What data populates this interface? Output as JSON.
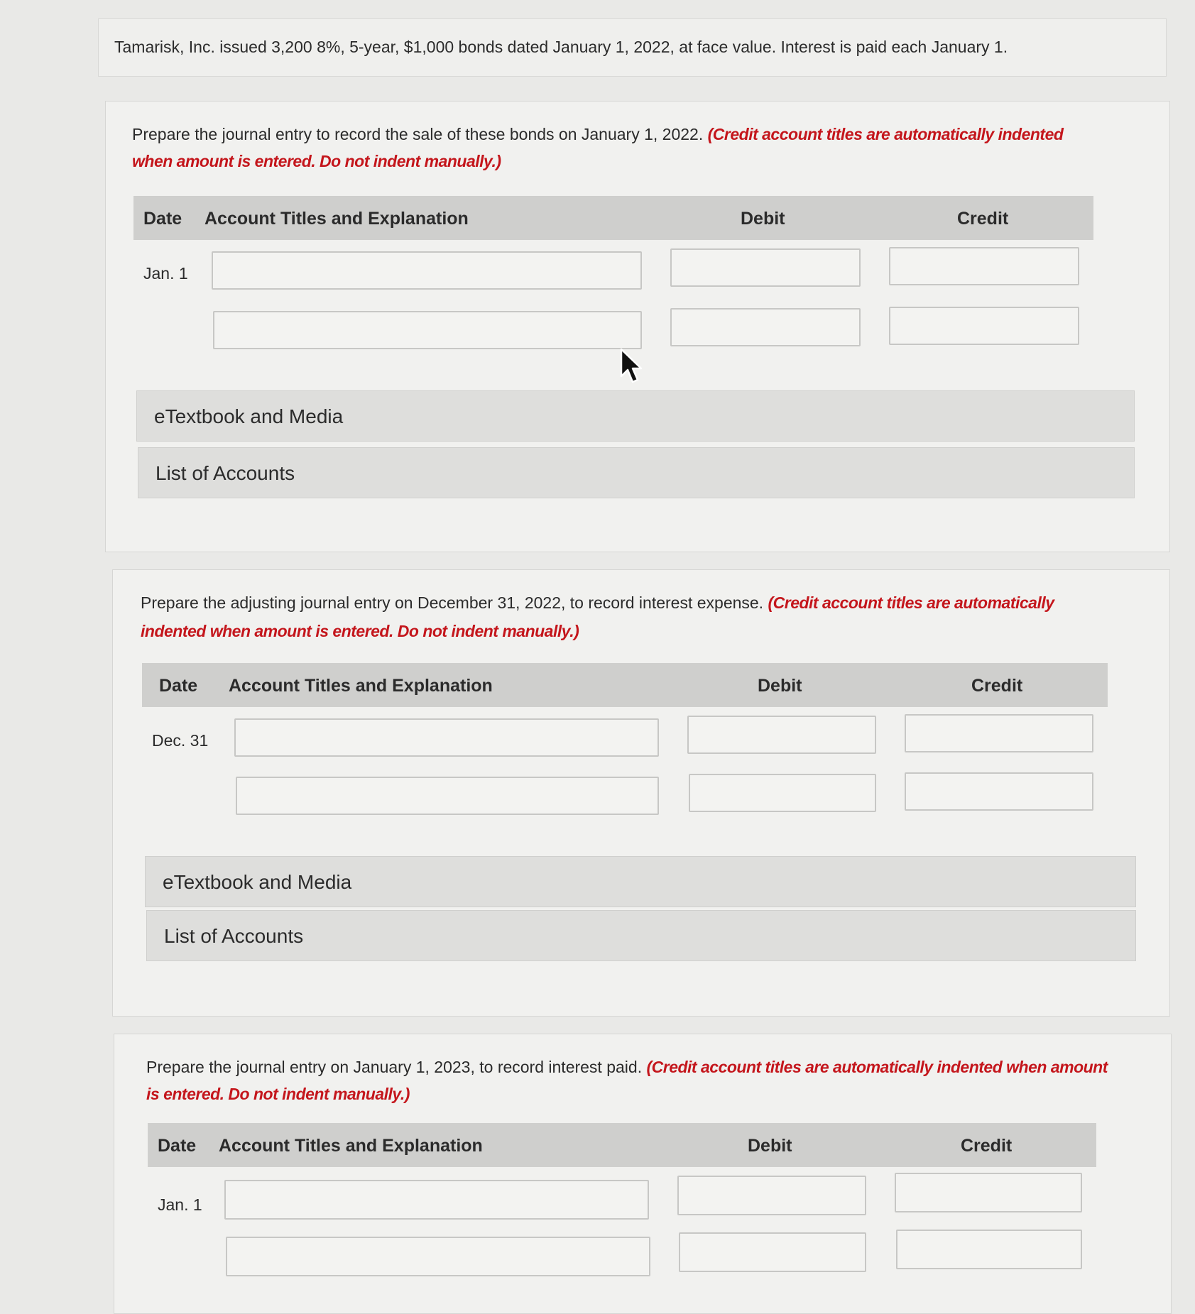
{
  "problem_text": "Tamarisk, Inc. issued 3,200 8%, 5-year, $1,000 bonds dated January 1, 2022, at face value. Interest is paid each January 1.",
  "headers": {
    "date": "Date",
    "account": "Account Titles and Explanation",
    "debit": "Debit",
    "credit": "Credit"
  },
  "links": {
    "etextbook": "eTextbook and Media",
    "accounts": "List of Accounts"
  },
  "sections": [
    {
      "instruction": "Prepare the journal entry to record the sale of these bonds on January 1, 2022.",
      "note_line1": "(Credit account titles are automatically indented",
      "note_line2": "when amount is entered. Do not indent manually.)",
      "date": "Jan. 1"
    },
    {
      "instruction": "Prepare the adjusting journal entry on December 31, 2022, to record interest expense.",
      "note_line1": "(Credit account titles are automatically",
      "note_line2": "indented when amount is entered. Do not indent manually.)",
      "date": "Dec. 31"
    },
    {
      "instruction": "Prepare the journal entry on January 1, 2023, to record interest paid.",
      "note_line1": "(Credit account titles are automatically indented when amount",
      "note_line2": "is entered. Do not indent manually.)",
      "date": "Jan. 1"
    }
  ]
}
